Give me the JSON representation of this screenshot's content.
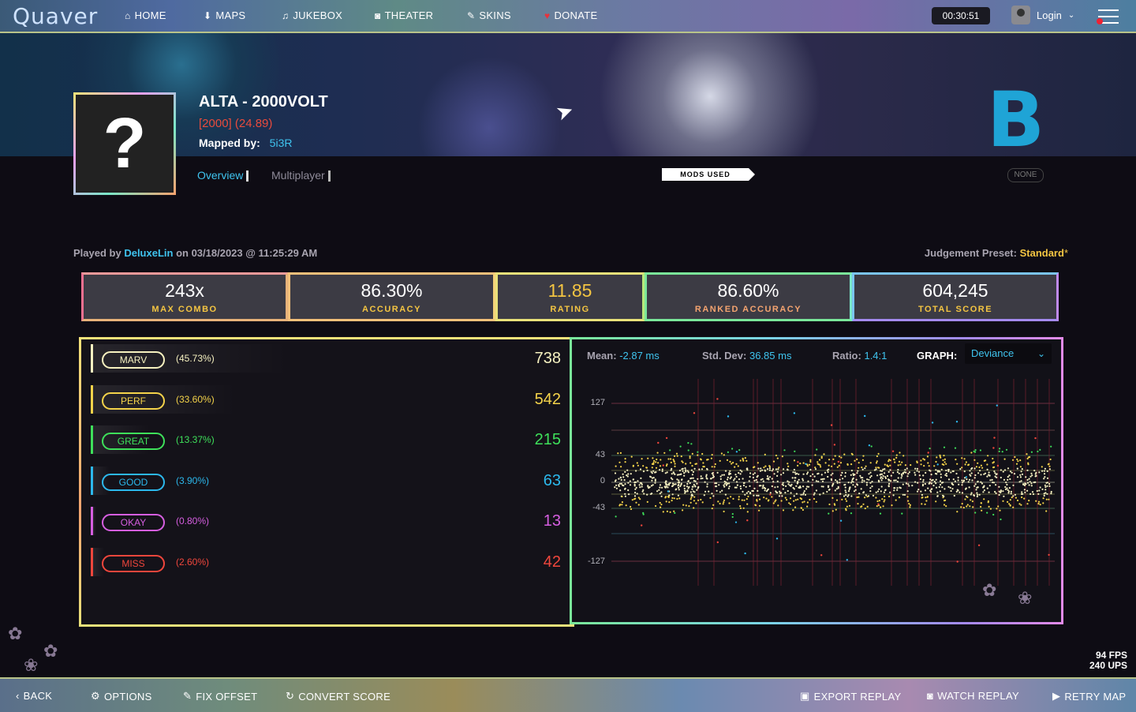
{
  "nav": {
    "logo": "Quaver",
    "items": [
      {
        "icon": "home-icon",
        "glyph": "⌂",
        "label": "HOME"
      },
      {
        "icon": "download-icon",
        "glyph": "⬇",
        "label": "MAPS"
      },
      {
        "icon": "music-note-icon",
        "glyph": "♫",
        "label": "JUKEBOX"
      },
      {
        "icon": "camera-icon",
        "glyph": "◙",
        "label": "THEATER"
      },
      {
        "icon": "brush-icon",
        "glyph": "✎",
        "label": "SKINS"
      },
      {
        "icon": "heart-icon",
        "glyph": "♥",
        "label": "DONATE"
      }
    ],
    "timer": "00:30:51",
    "login": "Login"
  },
  "map": {
    "title": "ALTA - 2000VOLT",
    "difficulty": "[2000] (24.89)",
    "mapped_by_label": "Mapped by:",
    "mapper": "5i3R",
    "grade": "B",
    "cover_placeholder": "?"
  },
  "tabs": {
    "overview": "Overview",
    "multiplayer": "Multiplayer"
  },
  "mods": {
    "label": "MODS USED",
    "value": "NONE"
  },
  "played": {
    "prefix": "Played by",
    "user": "DeluxeLin",
    "date": "on 03/18/2023 @ 11:25:29 AM",
    "preset_label": "Judgement Preset:",
    "preset_value": "Standard",
    "preset_suffix": "*"
  },
  "stats": [
    {
      "value": "243x",
      "label": "MAX COMBO",
      "value_color": "#ffffff",
      "label_color": "#f4c542"
    },
    {
      "value": "86.30%",
      "label": "ACCURACY",
      "value_color": "#ffffff",
      "label_color": "#f4c542"
    },
    {
      "value": "11.85",
      "label": "RATING",
      "value_color": "#f4c542",
      "label_color": "#f4c542"
    },
    {
      "value": "86.60%",
      "label": "RANKED ACCURACY",
      "value_color": "#ffffff",
      "label_color": "#f4a470"
    },
    {
      "value": "604,245",
      "label": "TOTAL SCORE",
      "value_color": "#ffffff",
      "label_color": "#f4c542"
    }
  ],
  "judgements": [
    {
      "name": "MARV",
      "pct": "(45.73%)",
      "count": "738",
      "color": "#f6f1c0",
      "frac": 0.4573
    },
    {
      "name": "PERF",
      "pct": "(33.60%)",
      "count": "542",
      "color": "#f4d34a",
      "frac": 0.336
    },
    {
      "name": "GREAT",
      "pct": "(13.37%)",
      "count": "215",
      "color": "#3ee05a",
      "frac": 0.1337
    },
    {
      "name": "GOOD",
      "pct": "(3.90%)",
      "count": "63",
      "color": "#2cb8ec",
      "frac": 0.039
    },
    {
      "name": "OKAY",
      "pct": "(0.80%)",
      "count": "13",
      "color": "#d65ee0",
      "frac": 0.008
    },
    {
      "name": "MISS",
      "pct": "(2.60%)",
      "count": "42",
      "color": "#f0463c",
      "frac": 0.026
    }
  ],
  "graph": {
    "mean_label": "Mean:",
    "mean": "-2.87 ms",
    "stddev_label": "Std. Dev:",
    "stddev": "36.85 ms",
    "ratio_label": "Ratio:",
    "ratio": "1.4:1",
    "graph_label": "GRAPH:",
    "graph_mode": "Deviance",
    "y_ticks": [
      "127",
      "43",
      "0",
      "-43",
      "-127"
    ]
  },
  "bottom": [
    {
      "icon": "chevron-left-icon",
      "glyph": "‹",
      "label": "BACK"
    },
    {
      "icon": "gear-icon",
      "glyph": "⚙",
      "label": "OPTIONS"
    },
    {
      "icon": "wrench-icon",
      "glyph": "✎",
      "label": "FIX OFFSET"
    },
    {
      "icon": "refresh-icon",
      "glyph": "↻",
      "label": "CONVERT SCORE"
    },
    {
      "icon": "export-icon",
      "glyph": "▣",
      "label": "EXPORT REPLAY"
    },
    {
      "icon": "camera-icon",
      "glyph": "◙",
      "label": "WATCH REPLAY"
    },
    {
      "icon": "play-icon",
      "glyph": "▶",
      "label": "RETRY MAP"
    }
  ],
  "perf": {
    "fps": "94 FPS",
    "ups": "240 UPS"
  }
}
